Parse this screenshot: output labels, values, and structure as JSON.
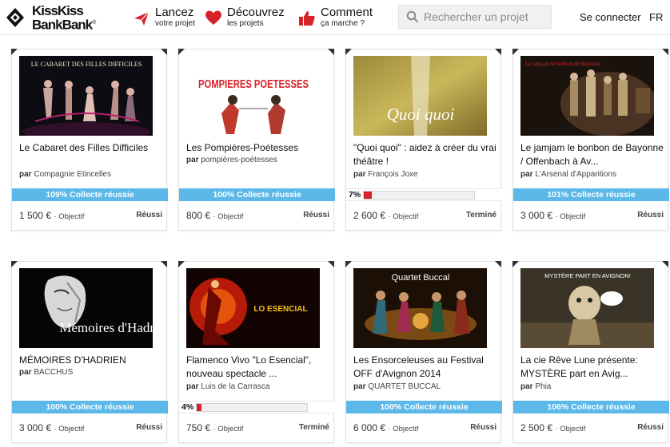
{
  "brand": {
    "line1": "KissKiss",
    "line2": "BankBank",
    "mark": "®"
  },
  "nav": [
    {
      "main": "Lancez",
      "sub": "votre projet",
      "icon": "paper-plane-icon",
      "color": "#d8222a"
    },
    {
      "main": "Découvrez",
      "sub": "les projets",
      "icon": "heart-icon",
      "color": "#d8222a"
    },
    {
      "main": "Comment",
      "sub": "ça marche ?",
      "icon": "thumbs-up-icon",
      "color": "#d8222a"
    }
  ],
  "search": {
    "placeholder": "Rechercher un projet"
  },
  "login": "Se connecter",
  "lang": "FR",
  "by_label": "par",
  "objective_label": "· Objectif",
  "colors": {
    "accent": "#d8222a",
    "success_bar": "#5bb8e8"
  },
  "projects": [
    {
      "title": "Le Cabaret des Filles Difficiles",
      "author": "Compagnie Etincelles",
      "funded_text": "109% Collecte réussie",
      "funded_percent": 109,
      "amount": "1 500 €",
      "status": "Réussi",
      "thumb_caption": "LE CABARET DES FILLES DIFFICILES"
    },
    {
      "title": "Les Pompières-Poétesses",
      "author": "pompières-poétesses",
      "funded_text": "100% Collecte réussie",
      "funded_percent": 100,
      "amount": "800 €",
      "status": "Réussi",
      "thumb_caption": "POMPIERES POETESSES"
    },
    {
      "title": "\"Quoi quoi\" : aidez à créer du vrai théâtre !",
      "author": "François Joxe",
      "progress_label": "7%",
      "funded_percent": 7,
      "amount": "2 600 €",
      "status": "Terminé",
      "thumb_caption": "Quoi quoi"
    },
    {
      "title": "Le jamjam le bonbon de Bayonne / Offenbach à Av...",
      "author": "L'Arsenal d'Apparitions",
      "funded_text": "101% Collecte réussie",
      "funded_percent": 101,
      "amount": "3 000 €",
      "status": "Réussi",
      "thumb_caption": "Le jamjam le bonbon de Bayonne"
    },
    {
      "title": "MÉMOIRES D'HADRIEN",
      "author": "BACCHUS",
      "funded_text": "100% Collecte réussie",
      "funded_percent": 100,
      "amount": "3 000 €",
      "status": "Réussi",
      "thumb_caption": "Mémoires d'Hadrien"
    },
    {
      "title": "Flamenco Vivo \"Lo Esencial\", nouveau spectacle ...",
      "author": "Luis de la Carrasca",
      "progress_label": "4%",
      "funded_percent": 4,
      "amount": "750 €",
      "status": "Terminé",
      "thumb_caption": "LO ESENCIAL"
    },
    {
      "title": "Les Ensorceleuses au Festival OFF d'Avignon 2014",
      "author": "QUARTET BUCCAL",
      "funded_text": "100% Collecte réussie",
      "funded_percent": 100,
      "amount": "6 000 €",
      "status": "Réussi",
      "thumb_caption": "Quartet Buccal"
    },
    {
      "title": "La cie Rêve Lune présente: MYSTÈRE part en Avig...",
      "author": "Phia",
      "funded_text": "106% Collecte réussie",
      "funded_percent": 106,
      "amount": "2 500 €",
      "status": "Réussi",
      "thumb_caption": "MYSTÈRE PART EN AVIGNON!"
    }
  ]
}
